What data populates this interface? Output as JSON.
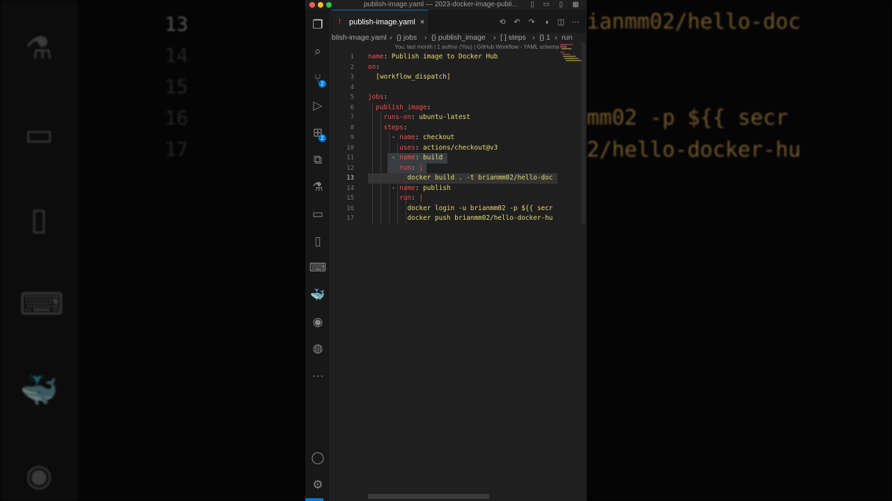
{
  "window": {
    "title": "publish-image.yaml — 2023-docker-image-publi...",
    "colors": {
      "accent": "#0078d4",
      "background": "#1f1f1f",
      "key": "#f14c4c",
      "value": "#e6db74"
    }
  },
  "tab": {
    "label": "publish-image.yaml",
    "close": "×",
    "icon": "yaml-file-icon"
  },
  "breadcrumb": [
    "blish-image.yaml",
    "{} jobs",
    "{} publish_image",
    "[ ] steps",
    "{} 1",
    "run"
  ],
  "breadcrumb_separator": "›",
  "codelens": "You, last month | 1 author (You) | GitHub Workflow - YAML schema for",
  "activity_bar": {
    "badges": {
      "source_control": "2",
      "extensions": "2"
    },
    "more": "···"
  },
  "editor": {
    "current_line": "13",
    "lines": [
      {
        "n": "1",
        "indent": "",
        "key": "name",
        "sep": ": ",
        "val": "Publish image to Docker Hub"
      },
      {
        "n": "2",
        "indent": "",
        "key": "on",
        "sep": ":",
        "val": ""
      },
      {
        "n": "3",
        "indent": "  ",
        "key": "",
        "sep": "",
        "val": "[workflow_dispatch]"
      },
      {
        "n": "4",
        "indent": "",
        "key": "",
        "sep": "",
        "val": ""
      },
      {
        "n": "5",
        "indent": "",
        "key": "jobs",
        "sep": ":",
        "val": ""
      },
      {
        "n": "6",
        "indent": "  ",
        "key": "publish_image",
        "sep": ":",
        "val": ""
      },
      {
        "n": "7",
        "indent": "    ",
        "key": "runs-on",
        "sep": ": ",
        "val": "ubuntu-latest"
      },
      {
        "n": "8",
        "indent": "    ",
        "key": "steps",
        "sep": ":",
        "val": ""
      },
      {
        "n": "9",
        "indent": "      - ",
        "key": "name",
        "sep": ": ",
        "val": "checkout"
      },
      {
        "n": "10",
        "indent": "        ",
        "key": "uses",
        "sep": ": ",
        "val": "actions/checkout@v3"
      },
      {
        "n": "11",
        "indent": "      - ",
        "key": "name",
        "sep": ": ",
        "val": "build"
      },
      {
        "n": "12",
        "indent": "        ",
        "key": "run",
        "sep": ": ",
        "val": "|"
      },
      {
        "n": "13",
        "indent": "          ",
        "key": "",
        "sep": "",
        "val": "docker build . -t brianmm02/hello-doc"
      },
      {
        "n": "14",
        "indent": "      - ",
        "key": "name",
        "sep": ": ",
        "val": "publish"
      },
      {
        "n": "15",
        "indent": "        ",
        "key": "run",
        "sep": ": ",
        "val": "|"
      },
      {
        "n": "16",
        "indent": "          ",
        "key": "",
        "sep": "",
        "val": "docker login -u brianmm02 -p ${{ secr"
      },
      {
        "n": "17",
        "indent": "          ",
        "key": "",
        "sep": "",
        "val": "docker push brianmm02/hello-docker-hu"
      }
    ]
  },
  "background": {
    "line_numbers": [
      "13",
      "14",
      "15",
      "16",
      "17"
    ],
    "code_right": [
      "ianmm02/hello-doc",
      "mm02 -p ${{ secr",
      "2/hello-docker-hu"
    ]
  }
}
